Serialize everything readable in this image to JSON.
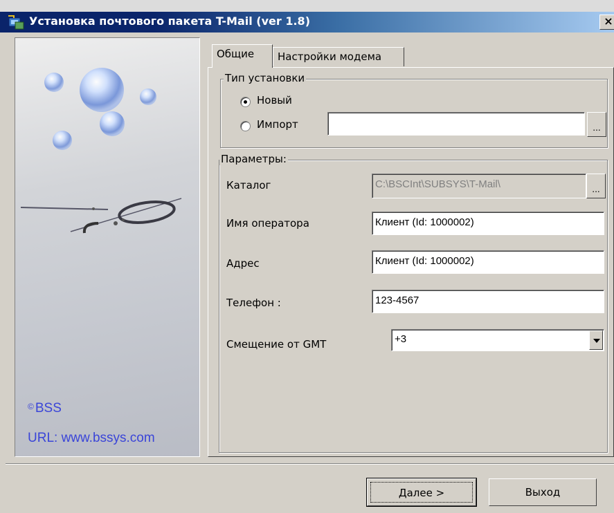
{
  "window": {
    "title": "Установка почтового пакета T-Mail (ver 1.8)",
    "close_label": "×"
  },
  "side_panel": {
    "copyright_symbol": "©",
    "copyright": "BSS",
    "url": "URL: www.bssys.com"
  },
  "tabs": [
    {
      "label": "Общие",
      "active": true
    },
    {
      "label": "Настройки модема",
      "active": false
    }
  ],
  "install_type": {
    "legend": "Тип установки",
    "options": [
      {
        "label": "Новый",
        "checked": true
      },
      {
        "label": "Импорт",
        "checked": false
      }
    ],
    "import_path": "",
    "browse_label": "..."
  },
  "params": {
    "legend": "Параметры:",
    "catalog_label": "Каталог",
    "catalog_value": "C:\\BSCInt\\SUBSYS\\T-Mail\\",
    "catalog_browse": "...",
    "operator_label": "Имя оператора",
    "operator_value": "Клиент (Id: 1000002)",
    "address_label": "Адрес",
    "address_value": "Клиент (Id: 1000002)",
    "phone_label": "Телефон :",
    "phone_value": "123-4567",
    "gmt_label": "Смещение от GMT",
    "gmt_value": "+3"
  },
  "buttons": {
    "next": "Далее >",
    "exit": "Выход"
  },
  "colors": {
    "titlebar_dark": "#0a246a",
    "titlebar_light": "#a6caf0",
    "face": "#d4d0c8",
    "link_text": "#3a45d8"
  }
}
